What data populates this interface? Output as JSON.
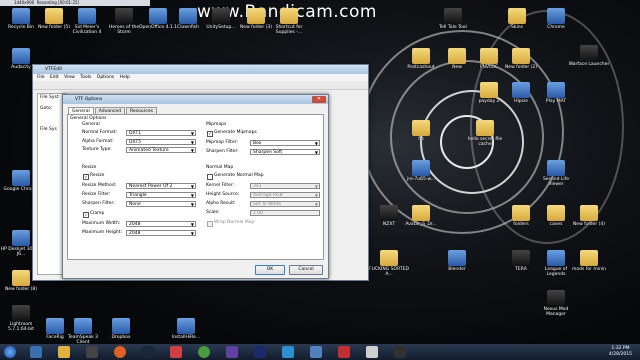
{
  "recorder": {
    "text": "Recording [00:01:25]",
    "size": "1440x900"
  },
  "watermark": "www.Bandicam.com",
  "desktop_icons": [
    {
      "label": "Recycle Bin",
      "kind": "app"
    },
    {
      "label": "New folder (5)",
      "kind": "folder"
    },
    {
      "label": "Sid Meier's Civilization 4",
      "kind": "app"
    },
    {
      "label": "Heroes of the Storm",
      "kind": "dark"
    },
    {
      "label": "OpenOffice 4.1.1",
      "kind": "app"
    },
    {
      "label": "Clownfish",
      "kind": "app"
    },
    {
      "label": "UnitySetup...",
      "kind": "dark"
    },
    {
      "label": "New folder (3)",
      "kind": "folder"
    },
    {
      "label": "Shortcut for Supplies -...",
      "kind": "folder"
    },
    {
      "label": "TeamSpeak 3 Client",
      "kind": "app"
    },
    {
      "label": "Dropbox",
      "kind": "app"
    },
    {
      "label": "InstallHiRe...",
      "kind": "app"
    },
    {
      "label": "Audacity",
      "kind": "app"
    },
    {
      "label": "Google Chrome",
      "kind": "app"
    },
    {
      "label": "HP Deskjet 3050A J6...",
      "kind": "app"
    },
    {
      "label": "New folder (8)",
      "kind": "folder"
    },
    {
      "label": "Lightroom 5.7.1.64-bit",
      "kind": "dark"
    },
    {
      "label": "FaceRig",
      "kind": "app"
    },
    {
      "label": "Tell Tale Tool",
      "kind": "dark"
    },
    {
      "label": "Skins",
      "kind": "folder"
    },
    {
      "label": "Chrome",
      "kind": "app"
    },
    {
      "label": "Warface Launcher",
      "kind": "dark"
    },
    {
      "label": "Postcashout",
      "kind": "folder"
    },
    {
      "label": "New",
      "kind": "folder"
    },
    {
      "label": "FNVLOC",
      "kind": "folder"
    },
    {
      "label": "New folder (2)",
      "kind": "folder"
    },
    {
      "label": "payday 2",
      "kind": "folder"
    },
    {
      "label": "Hlpsie",
      "kind": "app"
    },
    {
      "label": "Play MAT",
      "kind": "app"
    },
    {
      "label": "fts",
      "kind": "folder"
    },
    {
      "label": "hello secret file cache",
      "kind": "folder"
    },
    {
      "label": "jre-7u65-w...",
      "kind": "app"
    },
    {
      "label": "Second Life Viewer",
      "kind": "app"
    },
    {
      "label": "NZXT",
      "kind": "dark"
    },
    {
      "label": "Avatar_S_Dr...",
      "kind": "folder"
    },
    {
      "label": "folders",
      "kind": "folder"
    },
    {
      "label": "caves",
      "kind": "folder"
    },
    {
      "label": "New folder (4)",
      "kind": "folder"
    },
    {
      "label": "FUCKING SORTED A...",
      "kind": "folder"
    },
    {
      "label": "Blender",
      "kind": "app"
    },
    {
      "label": "TERA",
      "kind": "dark"
    },
    {
      "label": "League of Legends",
      "kind": "app"
    },
    {
      "label": "mods for minin",
      "kind": "folder"
    },
    {
      "label": "Nexus Mod Manager",
      "kind": "dark"
    }
  ],
  "bg_window": {
    "title": "VTFEdit",
    "menu": [
      "File",
      "Edit",
      "View",
      "Tools",
      "Options",
      "Help"
    ],
    "side_labels": [
      "File Syst",
      "Goto:",
      "File Sys"
    ]
  },
  "dialog": {
    "title": "VTF Options",
    "tabs": [
      "General",
      "Advanced",
      "Resources"
    ],
    "group_general": "General Options",
    "general": "General",
    "normal_format_label": "Normal Format:",
    "normal_format": "DXT1",
    "alpha_format_label": "Alpha Format:",
    "alpha_format": "DXT5",
    "texture_type_label": "Texture Type:",
    "texture_type": "Animated Texture",
    "resize": "Resize",
    "resize_chk": "Resize",
    "resize_method_label": "Resize Method:",
    "resize_method": "Nearest Power Of 2",
    "resize_filter_label": "Resize Filter:",
    "resize_filter": "Triangle",
    "sharpen_filter_label": "Sharpen Filter:",
    "sharpen_filter": "None",
    "clamp": "Clamp",
    "max_width_label": "Maximum Width:",
    "max_width": "2048",
    "max_height_label": "Maximum Height:",
    "max_height": "2048",
    "mipmaps": "Mipmaps",
    "gen_mipmaps": "Generate Mipmaps",
    "mipmap_filter_label": "Mipmap Filter:",
    "mipmap_filter": "Box",
    "mip_sharpen_label": "Sharpen Filter:",
    "mip_sharpen": "Sharpen Soft",
    "normal_map": "Normal Map",
    "gen_normal": "Generate Normal Map",
    "kernel_label": "Kernel Filter:",
    "kernel": "3x3",
    "height_src_label": "Height Source:",
    "height_src": "Average RGB",
    "alpha_result_label": "Alpha Result:",
    "alpha_result": "Set To White",
    "scale_label": "Scale:",
    "scale": "2.00",
    "wrap": "Wrap Normal Map",
    "ok": "OK",
    "cancel": "Cancel"
  },
  "clock": {
    "time": "1:32 PM",
    "date": "4/28/2015"
  }
}
